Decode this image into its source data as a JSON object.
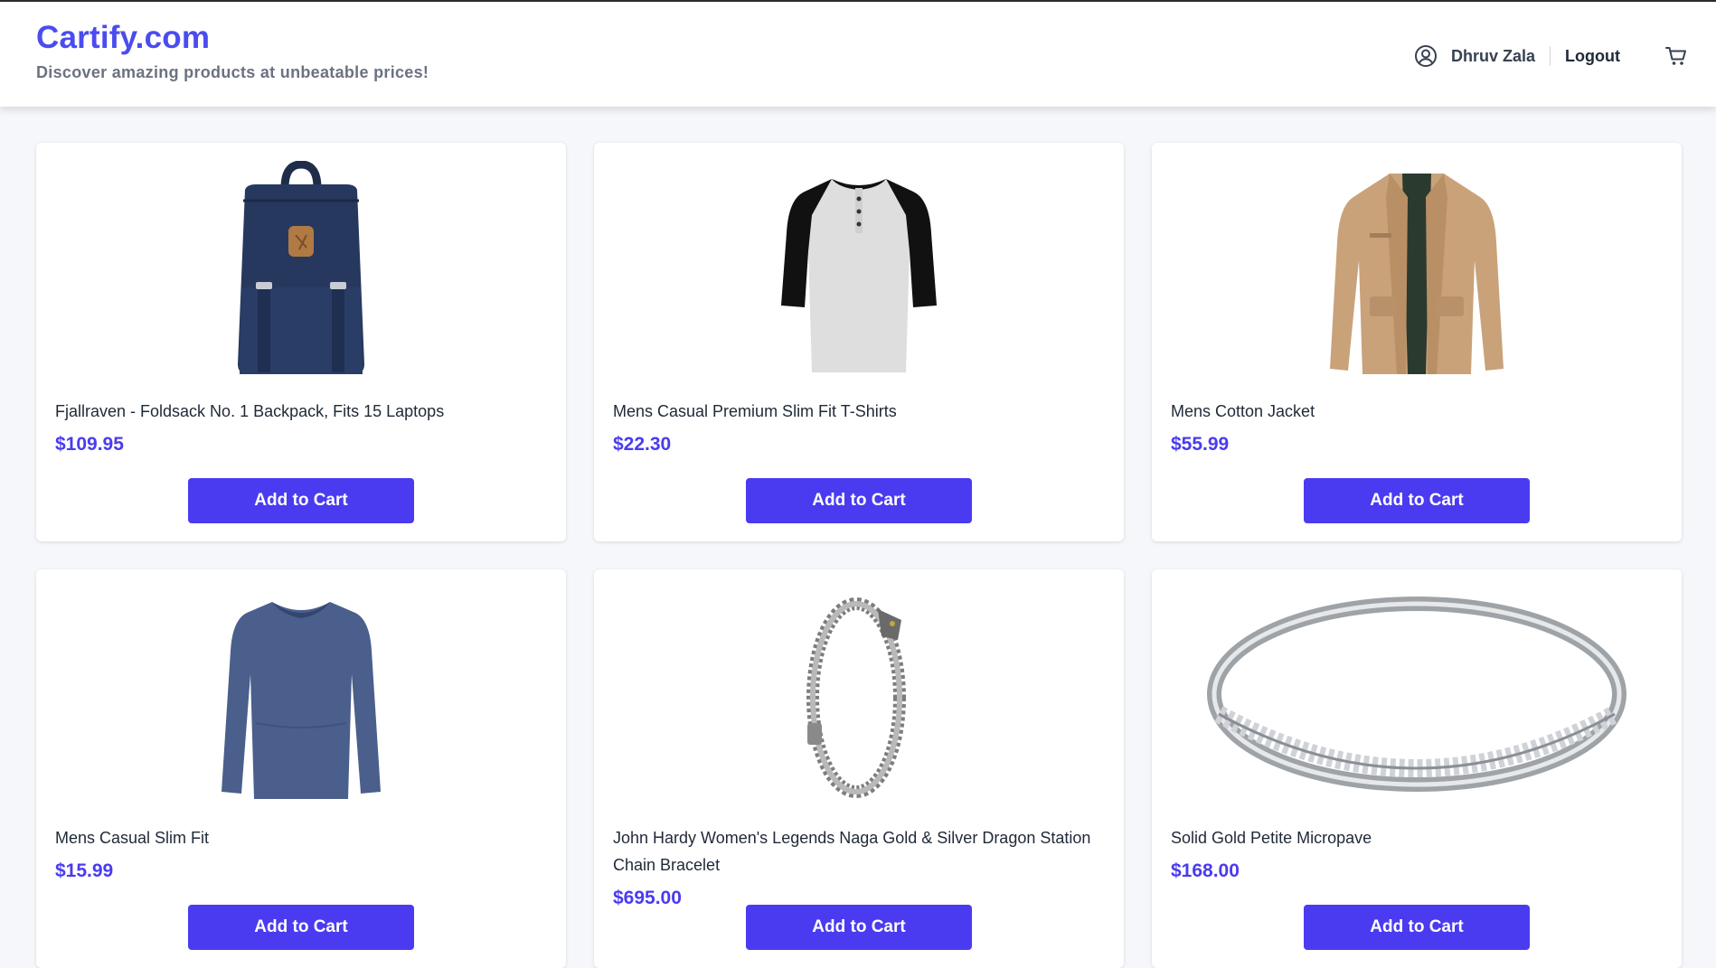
{
  "header": {
    "logo": "Cartify.com",
    "tagline": "Discover amazing products at unbeatable prices!",
    "user_name": "Dhruv Zala",
    "logout_label": "Logout",
    "user_icon": "user-circle-icon",
    "cart_icon": "cart-icon"
  },
  "colors": {
    "brand": "#4a4cf0",
    "accent": "#4a3bf0",
    "background": "#f5f7fa"
  },
  "products": [
    {
      "title": "Fjallraven - Foldsack No. 1 Backpack, Fits 15 Laptops",
      "price": "$109.95",
      "button": "Add to Cart",
      "image": "backpack-image"
    },
    {
      "title": "Mens Casual Premium Slim Fit T-Shirts",
      "price": "$22.30",
      "button": "Add to Cart",
      "image": "tshirt-image"
    },
    {
      "title": "Mens Cotton Jacket",
      "price": "$55.99",
      "button": "Add to Cart",
      "image": "jacket-image"
    },
    {
      "title": "Mens Casual Slim Fit",
      "price": "$15.99",
      "button": "Add to Cart",
      "image": "longsleeve-image"
    },
    {
      "title": "John Hardy Women's Legends Naga Gold & Silver Dragon Station Chain Bracelet",
      "price": "$695.00",
      "button": "Add to Cart",
      "image": "bracelet-image"
    },
    {
      "title": "Solid Gold Petite Micropave",
      "price": "$168.00",
      "button": "Add to Cart",
      "image": "ring-image"
    }
  ]
}
